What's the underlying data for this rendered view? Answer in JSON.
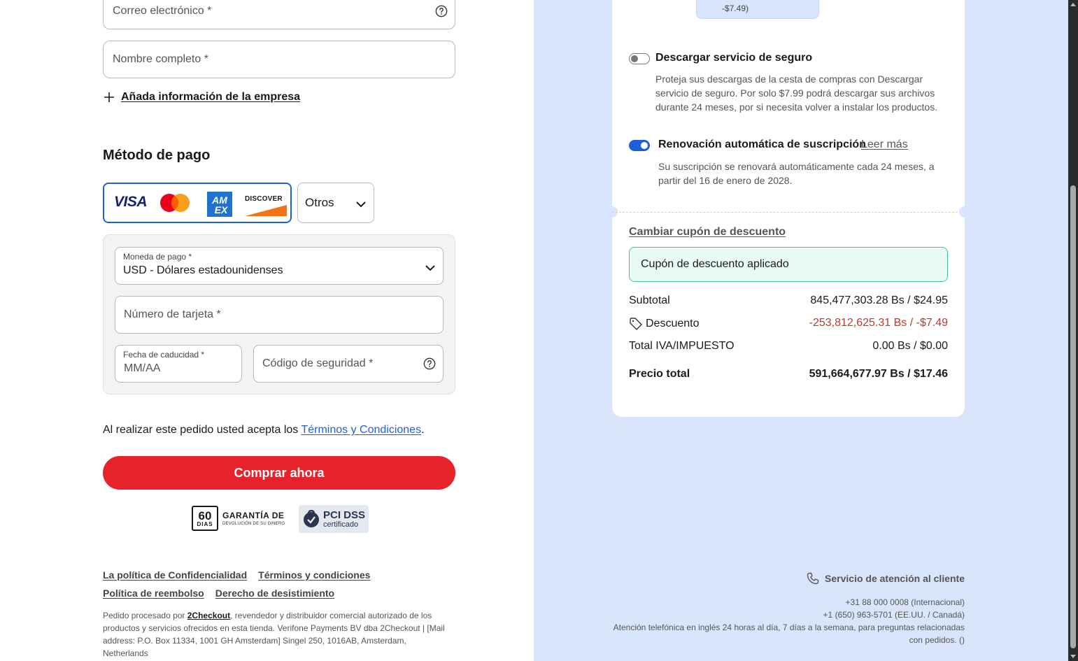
{
  "form": {
    "email_placeholder": "Correo electrónico *",
    "fullname_placeholder": "Nombre completo *",
    "add_company_label": "Añada información de la empresa"
  },
  "payment": {
    "section_title": "Método de pago",
    "card_brands": [
      "VISA",
      "DISCOVER"
    ],
    "others_label": "Otros",
    "currency_label": "Moneda de pago *",
    "currency_value": "USD - Dólares estadounidenses",
    "card_number_placeholder": "Número de tarjeta *",
    "expiry_label": "Fecha de caducidad *",
    "expiry_placeholder": "MM/AA",
    "cvv_placeholder": "Código de seguridad *"
  },
  "terms": {
    "prefix": "Al realizar este pedido usted acepta los ",
    "link": "Términos y Condiciones",
    "suffix": "."
  },
  "buy_button": "Comprar ahora",
  "badges": {
    "guarantee_days": "60",
    "guarantee_days_label": "DIAS",
    "guarantee_title": "GARANTÍA DE",
    "guarantee_sub": "DEVOLUCIÓN DE SU DINERO",
    "pci_title": "PCI DSS",
    "pci_sub": "certificado"
  },
  "footer": {
    "links_row1": [
      "La política de Confidencialidad",
      "Términos y condiciones"
    ],
    "links_row2": [
      "Política de reembolso",
      "Derecho de desistimiento"
    ],
    "legal_prefix": "Pedido procesado por ",
    "legal_company": "2Checkout",
    "legal_rest": ", revendedor y distribuidor comercial autorizado de los productos y servicios ofrecidos en esta tienda. Verifone Payments BV dba 2Checkout | [Mail address: P.O. Box 11334, 1001 GH Amsterdam] Singel 250, 1016AB, Amsterdam, Netherlands"
  },
  "summary": {
    "chip_value": "-$7.49)",
    "insurance_title": "Descargar servicio de seguro",
    "insurance_desc": "Proteja sus descargas de la cesta de compras con Descargar servicio de seguro. Por solo $7.99 podrá descargar sus archivos durante 24 meses, por si necesita volver a instalar los productos.",
    "insurance_enabled": false,
    "renewal_title": "Renovación automática de suscripción",
    "renewal_read_more": "Leer más",
    "renewal_desc": "Su suscripción se renovará automáticamente cada 24 meses, a partir del 16 de enero de 2028.",
    "renewal_enabled": true,
    "change_coupon": "Cambiar cupón de descuento",
    "coupon_applied": "Cupón de descuento aplicado",
    "subtotal_label": "Subtotal",
    "subtotal_value": "845,477,303.28 Bs / $24.95",
    "discount_label": "Descuento",
    "discount_value": "-253,812,625.31 Bs / -$7.49",
    "tax_label": "Total IVA/IMPUESTO",
    "tax_value": "0.00 Bs / $0.00",
    "total_label": "Precio total",
    "total_value": "591,664,677.97 Bs / $17.46"
  },
  "support": {
    "title": "Servicio de atención al cliente",
    "phone_intl": "+31 88 000 0008 (Internacional)",
    "phone_us": "+1 (650) 963-5701 (EE.UU. / Canadá)",
    "hours_line1": "Atención telefónica en inglés 24 horas al día, 7 días a la semana, para preguntas relacionadas",
    "hours_line2": "con pedidos. ()"
  },
  "colors": {
    "accent": "#1f5fd6",
    "buy": "#e8222a",
    "discount": "#c0392b",
    "right_bg": "#d9e5fc",
    "coupon_bg": "#e9fbf3"
  }
}
